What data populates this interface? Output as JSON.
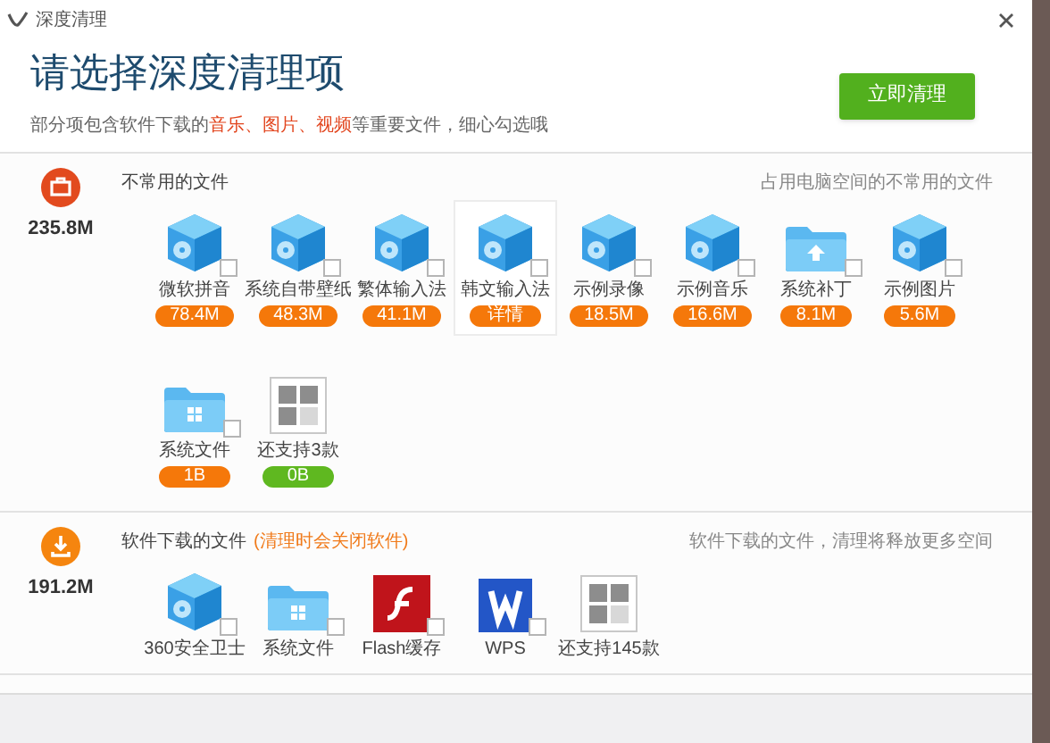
{
  "window": {
    "title": "深度清理"
  },
  "header": {
    "heading": "请选择深度清理项",
    "note": "部分项包含软件下载的**音乐、图片、视频**等重要文件，细心勾选哦",
    "clean_button": "立即清理"
  },
  "sections": [
    {
      "kind": "trash",
      "total": "235.8M",
      "title": "不常用的文件",
      "hint": "占用电脑空间的不常用的文件",
      "items": [
        {
          "kind": "cube",
          "label": "微软拼音",
          "badge": "78.4M",
          "color": "#f5780a",
          "checked": false,
          "highlighted": false
        },
        {
          "kind": "cube",
          "label": "系统自带壁纸",
          "badge": "48.3M",
          "color": "#f5780a",
          "checked": false,
          "highlighted": false
        },
        {
          "kind": "cube",
          "label": "繁体输入法",
          "badge": "41.1M",
          "color": "#f5780a",
          "checked": false,
          "highlighted": false
        },
        {
          "kind": "cube",
          "label": "韩文输入法",
          "badge": "详情",
          "color": "#f5780a",
          "checked": false,
          "highlighted": true
        },
        {
          "kind": "cube",
          "label": "示例录像",
          "badge": "18.5M",
          "color": "#f5780a",
          "checked": false,
          "highlighted": false
        },
        {
          "kind": "cube",
          "label": "示例音乐",
          "badge": "16.6M",
          "color": "#f5780a",
          "checked": false,
          "highlighted": false
        },
        {
          "kind": "folder-upload",
          "label": "系统补丁",
          "badge": "8.1M",
          "color": "#f5780a",
          "checked": false,
          "highlighted": false
        },
        {
          "kind": "cube",
          "label": "示例图片",
          "badge": "5.6M",
          "color": "#f5780a",
          "checked": false,
          "highlighted": false
        },
        {
          "kind": "folder-windows",
          "label": "系统文件",
          "badge": "1B",
          "color": "#f5780a",
          "checked": false,
          "highlighted": false
        },
        {
          "kind": "more",
          "label": "还支持3款",
          "badge": "0B",
          "color": "#5fb820",
          "highlighted": false
        }
      ]
    },
    {
      "kind": "download",
      "total": "191.2M",
      "title": "软件下载的文件",
      "warning": "(清理时会关闭软件)",
      "hint": "软件下载的文件，清理将释放更多空间",
      "items": [
        {
          "kind": "cube",
          "label": "360安全卫士",
          "checked": false,
          "highlighted": false
        },
        {
          "kind": "folder-windows",
          "label": "系统文件",
          "checked": false,
          "highlighted": false
        },
        {
          "kind": "flash",
          "label": "Flash缓存",
          "checked": false,
          "highlighted": false
        },
        {
          "kind": "wps",
          "label": "WPS",
          "checked": false,
          "highlighted": false
        },
        {
          "kind": "more",
          "label": "还支持145款",
          "highlighted": false
        }
      ]
    }
  ]
}
